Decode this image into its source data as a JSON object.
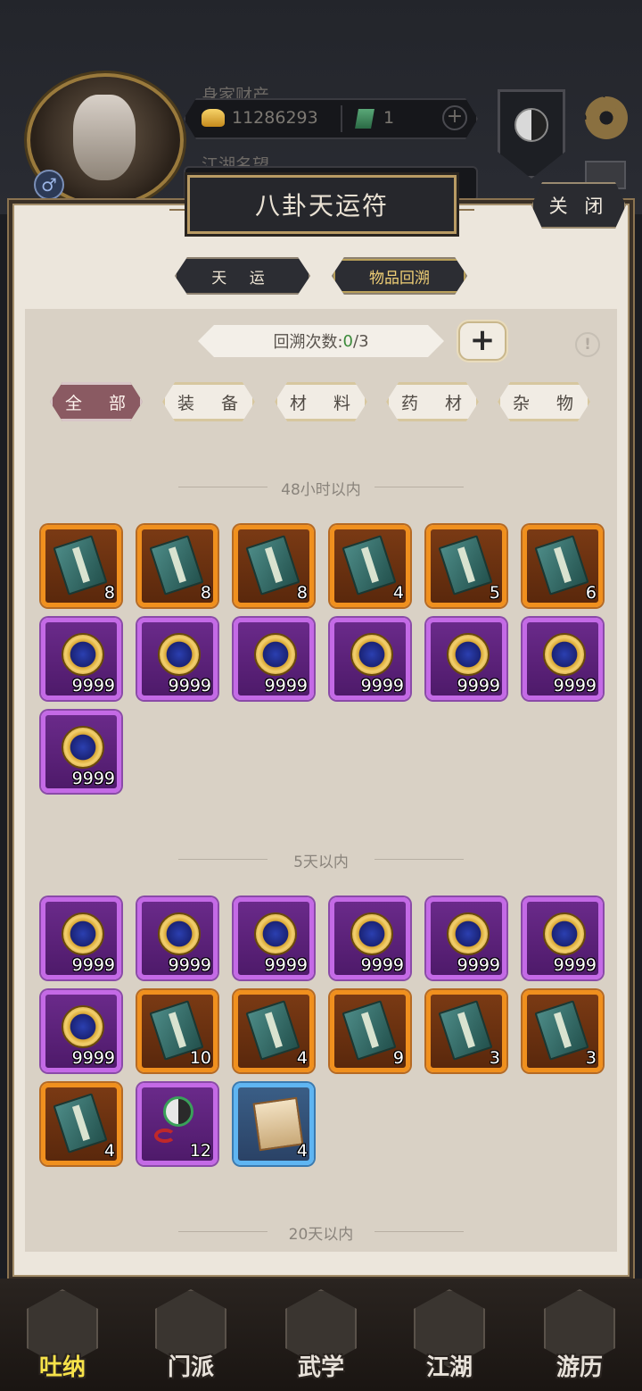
{
  "hud": {
    "wealth_label": "身家财产",
    "gold": "11286293",
    "jade": "1",
    "fame_label": "江湖名望",
    "gender_symbol": "♂"
  },
  "modal": {
    "title": "八卦天运符",
    "close": "关 闭",
    "tabs": [
      "天 运",
      "物品回溯"
    ],
    "recall_label": "回溯次数:",
    "recall_used": "0",
    "recall_total": "/3",
    "add_symbol": "+",
    "info_symbol": "!",
    "categories": [
      "全 部",
      "装 备",
      "材 料",
      "药 材",
      "杂 物"
    ],
    "active_category": "全 部"
  },
  "sections": [
    {
      "title": "48小时以内",
      "items": [
        {
          "kind": "book",
          "rarity": "orange",
          "qty": "8"
        },
        {
          "kind": "book",
          "rarity": "orange",
          "qty": "8"
        },
        {
          "kind": "book",
          "rarity": "orange",
          "qty": "8"
        },
        {
          "kind": "book",
          "rarity": "orange",
          "qty": "4"
        },
        {
          "kind": "book",
          "rarity": "orange",
          "qty": "5"
        },
        {
          "kind": "book",
          "rarity": "orange",
          "qty": "6"
        },
        {
          "kind": "coin",
          "rarity": "purple",
          "qty": "9999"
        },
        {
          "kind": "coin",
          "rarity": "purple",
          "qty": "9999"
        },
        {
          "kind": "coin",
          "rarity": "purple",
          "qty": "9999"
        },
        {
          "kind": "coin",
          "rarity": "purple",
          "qty": "9999"
        },
        {
          "kind": "coin",
          "rarity": "purple",
          "qty": "9999"
        },
        {
          "kind": "coin",
          "rarity": "purple",
          "qty": "9999"
        },
        {
          "kind": "coin",
          "rarity": "purple",
          "qty": "9999"
        }
      ]
    },
    {
      "title": "5天以内",
      "items": [
        {
          "kind": "coin",
          "rarity": "purple",
          "qty": "9999"
        },
        {
          "kind": "coin",
          "rarity": "purple",
          "qty": "9999"
        },
        {
          "kind": "coin",
          "rarity": "purple",
          "qty": "9999"
        },
        {
          "kind": "coin",
          "rarity": "purple",
          "qty": "9999"
        },
        {
          "kind": "coin",
          "rarity": "purple",
          "qty": "9999"
        },
        {
          "kind": "coin",
          "rarity": "purple",
          "qty": "9999"
        },
        {
          "kind": "coin",
          "rarity": "purple",
          "qty": "9999"
        },
        {
          "kind": "book",
          "rarity": "orange",
          "qty": "10"
        },
        {
          "kind": "book",
          "rarity": "orange",
          "qty": "4"
        },
        {
          "kind": "book",
          "rarity": "orange",
          "qty": "9"
        },
        {
          "kind": "book",
          "rarity": "orange",
          "qty": "3"
        },
        {
          "kind": "book",
          "rarity": "orange",
          "qty": "3"
        },
        {
          "kind": "book",
          "rarity": "orange",
          "qty": "4"
        },
        {
          "kind": "pendant",
          "rarity": "purple",
          "qty": "12"
        },
        {
          "kind": "letter",
          "rarity": "blue",
          "qty": "4"
        }
      ]
    },
    {
      "title": "20天以内",
      "items": []
    }
  ],
  "nav": [
    "吐纳",
    "门派",
    "武学",
    "江湖",
    "游历"
  ],
  "nav_active": "吐纳",
  "colors": {
    "orange_border": "#f0901e",
    "purple_border": "#c46ae6",
    "blue_border": "#5fb5f2",
    "active_category": "#8a5a62",
    "recall_used": "#3b8a3a"
  }
}
